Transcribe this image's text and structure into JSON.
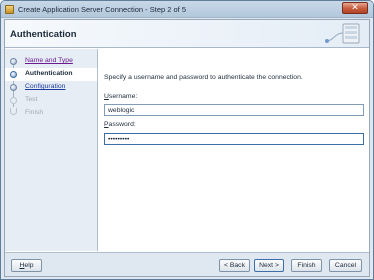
{
  "window": {
    "title": "Create Application Server Connection - Step 2 of 5",
    "close_glyph": "✕"
  },
  "header": {
    "title": "Authentication"
  },
  "nav": {
    "items": [
      {
        "label": "Name and Type",
        "state": "visited"
      },
      {
        "label": "Authentication",
        "state": "current"
      },
      {
        "label": "Configuration",
        "state": "link"
      },
      {
        "label": "Test",
        "state": "disabled"
      },
      {
        "label": "Finish",
        "state": "disabled"
      }
    ]
  },
  "main": {
    "instruction": "Specify a username and password to authenticate the connection.",
    "username": {
      "label_mnemonic": "U",
      "label_rest": "sername:",
      "value": "weblogic"
    },
    "password": {
      "label_mnemonic": "P",
      "label_rest": "assword:",
      "value": "•••••••••"
    }
  },
  "footer": {
    "help_mnemonic": "H",
    "help_rest": "elp",
    "back": "< Back",
    "next": "Next >",
    "finish": "Finish",
    "cancel": "Cancel"
  }
}
